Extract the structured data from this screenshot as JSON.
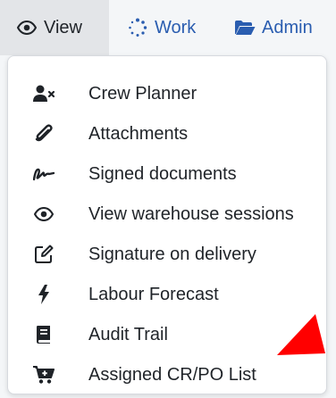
{
  "topnav": {
    "tabs": [
      {
        "label": "View",
        "icon": "eye-icon",
        "active": true
      },
      {
        "label": "Work",
        "icon": "spinner-icon",
        "active": false
      },
      {
        "label": "Admin",
        "icon": "folder-open-icon",
        "active": false
      }
    ]
  },
  "menu": {
    "items": [
      {
        "label": "Crew Planner",
        "icon": "user-remove-icon"
      },
      {
        "label": "Attachments",
        "icon": "paperclip-icon"
      },
      {
        "label": "Signed documents",
        "icon": "signature-icon"
      },
      {
        "label": "View warehouse sessions",
        "icon": "eye-icon"
      },
      {
        "label": "Signature on delivery",
        "icon": "pen-square-icon"
      },
      {
        "label": "Labour Forecast",
        "icon": "bolt-icon"
      },
      {
        "label": "Audit Trail",
        "icon": "book-icon"
      },
      {
        "label": "Assigned CR/PO List",
        "icon": "cart-plus-icon"
      }
    ]
  },
  "colors": {
    "link": "#2a5db0",
    "active_tab_bg": "#e3e5e8",
    "arrow": "#ff0000"
  }
}
